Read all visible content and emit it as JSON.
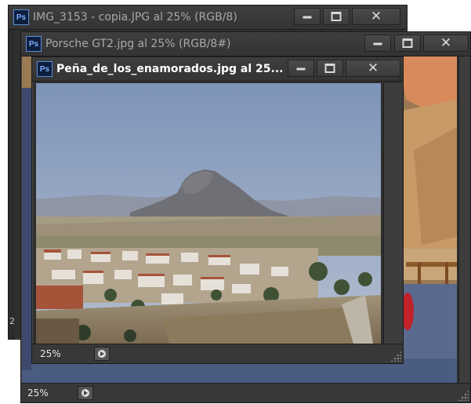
{
  "app": {
    "icon_text": "Ps"
  },
  "windows": [
    {
      "title": "IMG_3153 - copia.JPG al 25% (RGB/8)",
      "side_digit": "2"
    },
    {
      "title": "Porsche GT2.jpg al 25% (RGB/8#)",
      "zoom": "25%"
    },
    {
      "title": "Peña_de_los_enamorados.jpg al 25...",
      "zoom": "25%"
    }
  ],
  "colors": {
    "title_active": "#ffffff",
    "title_inactive": "#a8a8a8",
    "panel_bg": "#2f2f2f",
    "ps_icon_blue": "#7fb3ff"
  },
  "icons": {
    "minimize": "minimize-icon",
    "maximize": "maximize-icon",
    "close": "close-icon",
    "status_menu": "status-arrow-icon",
    "resize": "resize-grip-icon"
  }
}
